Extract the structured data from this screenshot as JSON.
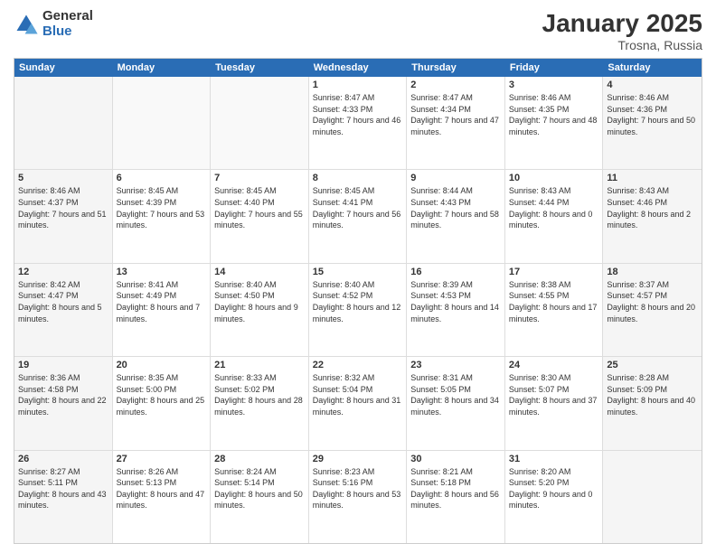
{
  "logo": {
    "general": "General",
    "blue": "Blue"
  },
  "header": {
    "title": "January 2025",
    "subtitle": "Trosna, Russia"
  },
  "weekdays": [
    "Sunday",
    "Monday",
    "Tuesday",
    "Wednesday",
    "Thursday",
    "Friday",
    "Saturday"
  ],
  "weeks": [
    [
      {
        "day": "",
        "info": ""
      },
      {
        "day": "",
        "info": ""
      },
      {
        "day": "",
        "info": ""
      },
      {
        "day": "1",
        "info": "Sunrise: 8:47 AM\nSunset: 4:33 PM\nDaylight: 7 hours and 46 minutes."
      },
      {
        "day": "2",
        "info": "Sunrise: 8:47 AM\nSunset: 4:34 PM\nDaylight: 7 hours and 47 minutes."
      },
      {
        "day": "3",
        "info": "Sunrise: 8:46 AM\nSunset: 4:35 PM\nDaylight: 7 hours and 48 minutes."
      },
      {
        "day": "4",
        "info": "Sunrise: 8:46 AM\nSunset: 4:36 PM\nDaylight: 7 hours and 50 minutes."
      }
    ],
    [
      {
        "day": "5",
        "info": "Sunrise: 8:46 AM\nSunset: 4:37 PM\nDaylight: 7 hours and 51 minutes."
      },
      {
        "day": "6",
        "info": "Sunrise: 8:45 AM\nSunset: 4:39 PM\nDaylight: 7 hours and 53 minutes."
      },
      {
        "day": "7",
        "info": "Sunrise: 8:45 AM\nSunset: 4:40 PM\nDaylight: 7 hours and 55 minutes."
      },
      {
        "day": "8",
        "info": "Sunrise: 8:45 AM\nSunset: 4:41 PM\nDaylight: 7 hours and 56 minutes."
      },
      {
        "day": "9",
        "info": "Sunrise: 8:44 AM\nSunset: 4:43 PM\nDaylight: 7 hours and 58 minutes."
      },
      {
        "day": "10",
        "info": "Sunrise: 8:43 AM\nSunset: 4:44 PM\nDaylight: 8 hours and 0 minutes."
      },
      {
        "day": "11",
        "info": "Sunrise: 8:43 AM\nSunset: 4:46 PM\nDaylight: 8 hours and 2 minutes."
      }
    ],
    [
      {
        "day": "12",
        "info": "Sunrise: 8:42 AM\nSunset: 4:47 PM\nDaylight: 8 hours and 5 minutes."
      },
      {
        "day": "13",
        "info": "Sunrise: 8:41 AM\nSunset: 4:49 PM\nDaylight: 8 hours and 7 minutes."
      },
      {
        "day": "14",
        "info": "Sunrise: 8:40 AM\nSunset: 4:50 PM\nDaylight: 8 hours and 9 minutes."
      },
      {
        "day": "15",
        "info": "Sunrise: 8:40 AM\nSunset: 4:52 PM\nDaylight: 8 hours and 12 minutes."
      },
      {
        "day": "16",
        "info": "Sunrise: 8:39 AM\nSunset: 4:53 PM\nDaylight: 8 hours and 14 minutes."
      },
      {
        "day": "17",
        "info": "Sunrise: 8:38 AM\nSunset: 4:55 PM\nDaylight: 8 hours and 17 minutes."
      },
      {
        "day": "18",
        "info": "Sunrise: 8:37 AM\nSunset: 4:57 PM\nDaylight: 8 hours and 20 minutes."
      }
    ],
    [
      {
        "day": "19",
        "info": "Sunrise: 8:36 AM\nSunset: 4:58 PM\nDaylight: 8 hours and 22 minutes."
      },
      {
        "day": "20",
        "info": "Sunrise: 8:35 AM\nSunset: 5:00 PM\nDaylight: 8 hours and 25 minutes."
      },
      {
        "day": "21",
        "info": "Sunrise: 8:33 AM\nSunset: 5:02 PM\nDaylight: 8 hours and 28 minutes."
      },
      {
        "day": "22",
        "info": "Sunrise: 8:32 AM\nSunset: 5:04 PM\nDaylight: 8 hours and 31 minutes."
      },
      {
        "day": "23",
        "info": "Sunrise: 8:31 AM\nSunset: 5:05 PM\nDaylight: 8 hours and 34 minutes."
      },
      {
        "day": "24",
        "info": "Sunrise: 8:30 AM\nSunset: 5:07 PM\nDaylight: 8 hours and 37 minutes."
      },
      {
        "day": "25",
        "info": "Sunrise: 8:28 AM\nSunset: 5:09 PM\nDaylight: 8 hours and 40 minutes."
      }
    ],
    [
      {
        "day": "26",
        "info": "Sunrise: 8:27 AM\nSunset: 5:11 PM\nDaylight: 8 hours and 43 minutes."
      },
      {
        "day": "27",
        "info": "Sunrise: 8:26 AM\nSunset: 5:13 PM\nDaylight: 8 hours and 47 minutes."
      },
      {
        "day": "28",
        "info": "Sunrise: 8:24 AM\nSunset: 5:14 PM\nDaylight: 8 hours and 50 minutes."
      },
      {
        "day": "29",
        "info": "Sunrise: 8:23 AM\nSunset: 5:16 PM\nDaylight: 8 hours and 53 minutes."
      },
      {
        "day": "30",
        "info": "Sunrise: 8:21 AM\nSunset: 5:18 PM\nDaylight: 8 hours and 56 minutes."
      },
      {
        "day": "31",
        "info": "Sunrise: 8:20 AM\nSunset: 5:20 PM\nDaylight: 9 hours and 0 minutes."
      },
      {
        "day": "",
        "info": ""
      }
    ]
  ]
}
